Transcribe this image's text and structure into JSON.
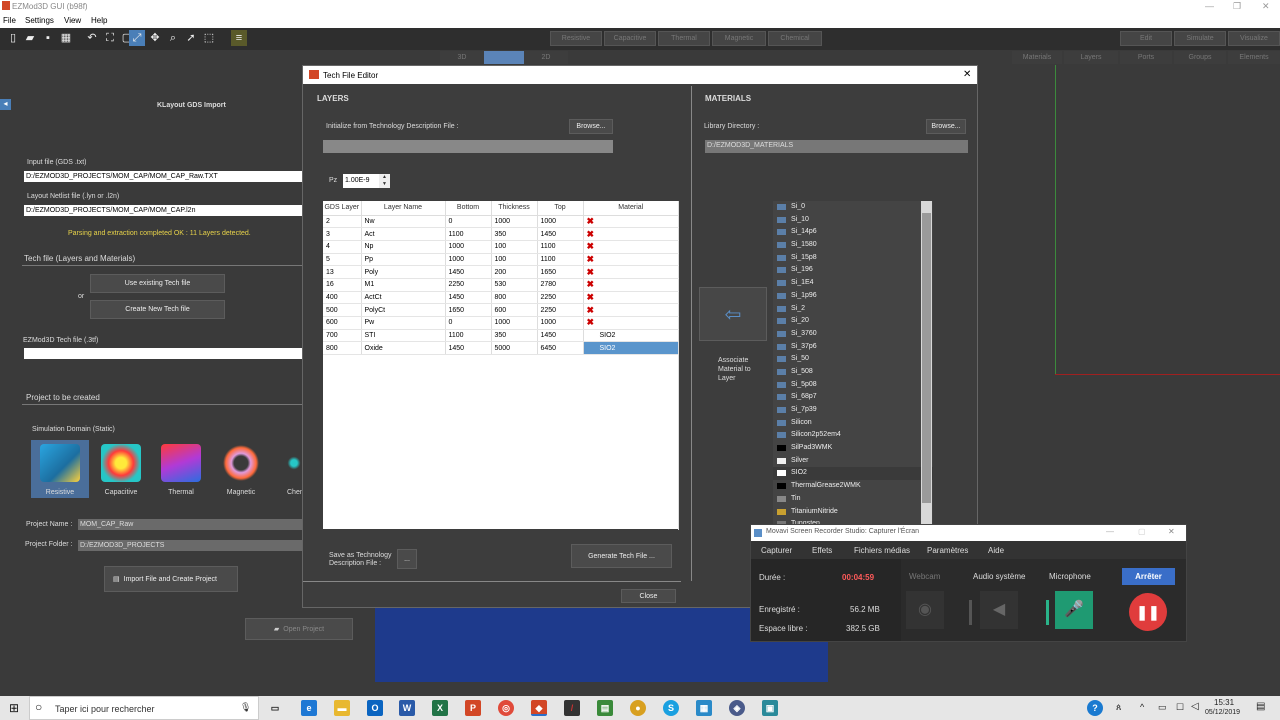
{
  "app": {
    "title": "EZMod3D GUI (b98f)"
  },
  "menu": [
    "File",
    "Settings",
    "View",
    "Help"
  ],
  "domain_tabs": [
    "Resistive",
    "Capacitive",
    "Thermal",
    "Magnetic",
    "Chemical"
  ],
  "right_tabs1": [
    "Edit",
    "Simulate",
    "Visualize"
  ],
  "right_tabs2": [
    "Materials",
    "Layers",
    "Ports",
    "Groups",
    "Elements"
  ],
  "view_tabs": [
    "3D",
    "",
    "2D"
  ],
  "left": {
    "header": "KLayout GDS Import",
    "input_label": "Input file (GDS .txt)",
    "input_value": "D:/EZMOD3D_PROJECTS/MOM_CAP/MOM_CAP_Raw.TXT",
    "netlist_label": "Layout Netlist file (.lyn or .l2n)",
    "netlist_value": "D:/EZMOD3D_PROJECTS/MOM_CAP/MOM_CAP.l2n",
    "status": "Parsing and extraction completed OK : 11 Layers detected.",
    "tech_section": "Tech file (Layers and Materials)",
    "use_existing": "Use existing Tech file",
    "or": "or",
    "create_new": "Create New Tech file",
    "tech_file_label": "EZMod3D Tech file (.3tf)",
    "project_section": "Project to be created",
    "sim_domain_label": "Simulation Domain (Static)",
    "domains": [
      "Resistive",
      "Capacitive",
      "Thermal",
      "Magnetic",
      "Chem"
    ],
    "project_name_label": "Project Name :",
    "project_name": "MOM_CAP_Raw",
    "project_folder_label": "Project Folder :",
    "project_folder": "D:/EZMOD3D_PROJECTS",
    "import_button": "Import File and Create Project",
    "open_project": "Open Project"
  },
  "dialog": {
    "title": "Tech File Editor",
    "layers_header": "LAYERS",
    "materials_header": "MATERIALS",
    "init_label": "Initialize from Technology Description File :",
    "browse": "Browse...",
    "library_label": "Library Directory :",
    "library_value": "D:/EZMOD3D_MATERIALS",
    "pz_label": "Pz",
    "pz_value": "1.00E-9",
    "columns": [
      "GDS Layer",
      "Layer Name",
      "Bottom",
      "Thickness",
      "Top",
      "Material"
    ],
    "rows": [
      [
        "2",
        "Nw",
        "0",
        "1000",
        "1000",
        "✖"
      ],
      [
        "3",
        "Act",
        "1100",
        "350",
        "1450",
        "✖"
      ],
      [
        "4",
        "Np",
        "1000",
        "100",
        "1100",
        "✖"
      ],
      [
        "5",
        "Pp",
        "1000",
        "100",
        "1100",
        "✖"
      ],
      [
        "13",
        "Poly",
        "1450",
        "200",
        "1650",
        "✖"
      ],
      [
        "16",
        "M1",
        "2250",
        "530",
        "2780",
        "✖"
      ],
      [
        "400",
        "ActCt",
        "1450",
        "800",
        "2250",
        "✖"
      ],
      [
        "500",
        "PolyCt",
        "1650",
        "600",
        "2250",
        "✖"
      ],
      [
        "600",
        "Pw",
        "0",
        "1000",
        "1000",
        "✖"
      ],
      [
        "700",
        "STI",
        "1100",
        "350",
        "1450",
        "SIO2"
      ],
      [
        "800",
        "Oxide",
        "1450",
        "5000",
        "6450",
        "SIO2"
      ]
    ],
    "associate": "Associate Material to Layer",
    "save_as": "Save as Technology Description File :",
    "ellipsis": "...",
    "generate": "Generate Tech File ...",
    "close": "Close",
    "materials": [
      {
        "name": "Si_0",
        "color": "#5b7fa8"
      },
      {
        "name": "Si_10",
        "color": "#5b7fa8"
      },
      {
        "name": "Si_14p6",
        "color": "#5b7fa8"
      },
      {
        "name": "Si_1580",
        "color": "#5b7fa8"
      },
      {
        "name": "Si_15p8",
        "color": "#5b7fa8"
      },
      {
        "name": "Si_196",
        "color": "#5b7fa8"
      },
      {
        "name": "Si_1E4",
        "color": "#5b7fa8"
      },
      {
        "name": "Si_1p96",
        "color": "#5b7fa8"
      },
      {
        "name": "Si_2",
        "color": "#5b7fa8"
      },
      {
        "name": "Si_20",
        "color": "#5b7fa8"
      },
      {
        "name": "Si_3760",
        "color": "#5b7fa8"
      },
      {
        "name": "Si_37p6",
        "color": "#5b7fa8"
      },
      {
        "name": "Si_50",
        "color": "#5b7fa8"
      },
      {
        "name": "Si_508",
        "color": "#5b7fa8"
      },
      {
        "name": "Si_5p08",
        "color": "#5b7fa8"
      },
      {
        "name": "Si_68p7",
        "color": "#5b7fa8"
      },
      {
        "name": "Si_7p39",
        "color": "#5b7fa8"
      },
      {
        "name": "Silicon",
        "color": "#5b7fa8"
      },
      {
        "name": "Silicon2p52em4",
        "color": "#5b7fa8"
      },
      {
        "name": "SilPad3WMK",
        "color": "#000000"
      },
      {
        "name": "Silver",
        "color": "#f0f0f0"
      },
      {
        "name": "SIO2",
        "color": "#ffffff"
      },
      {
        "name": "ThermalGrease2WMK",
        "color": "#000000"
      },
      {
        "name": "Tin",
        "color": "#888888"
      },
      {
        "name": "TitaniumNitride",
        "color": "#c8a030"
      },
      {
        "name": "Tungsten",
        "color": "#777777"
      }
    ]
  },
  "recorder": {
    "title": "Movavi Screen Recorder Studio: Capturer l'Écran",
    "menu": [
      "Capturer",
      "Effets",
      "Fichiers médias",
      "Paramètres",
      "Aide"
    ],
    "duree_label": "Durée :",
    "duree": "00:04:59",
    "webcam": "Webcam",
    "audio": "Audio système",
    "microphone": "Microphone",
    "arreter": "Arrêter",
    "enregistre_label": "Enregistré :",
    "enregistre": "56.2 MB",
    "espace_label": "Espace libre :",
    "espace": "382.5 GB"
  },
  "taskbar": {
    "search": "Taper ici pour rechercher",
    "time": "15:31",
    "date": "05/12/2019"
  }
}
